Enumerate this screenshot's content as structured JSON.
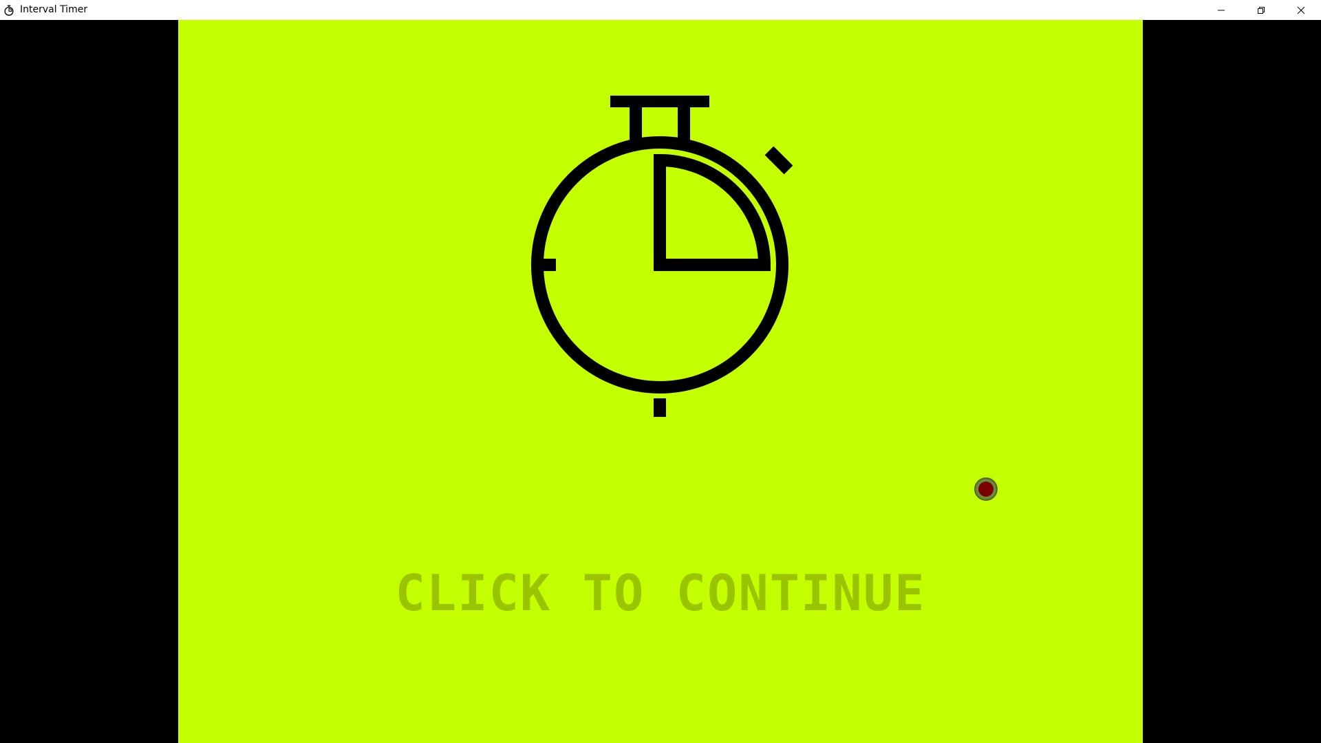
{
  "window": {
    "title": "Interval Timer",
    "icon": "stopwatch-icon",
    "controls": {
      "minimize_icon": "minimize-icon",
      "restore_icon": "restore-icon",
      "close_icon": "close-icon"
    }
  },
  "game": {
    "background_color": "#c4ff00",
    "icon": "stopwatch-icon",
    "prompt": "CLICK TO CONTINUE",
    "prompt_color": "#9bc400",
    "cursor_color": "#7a0000"
  }
}
